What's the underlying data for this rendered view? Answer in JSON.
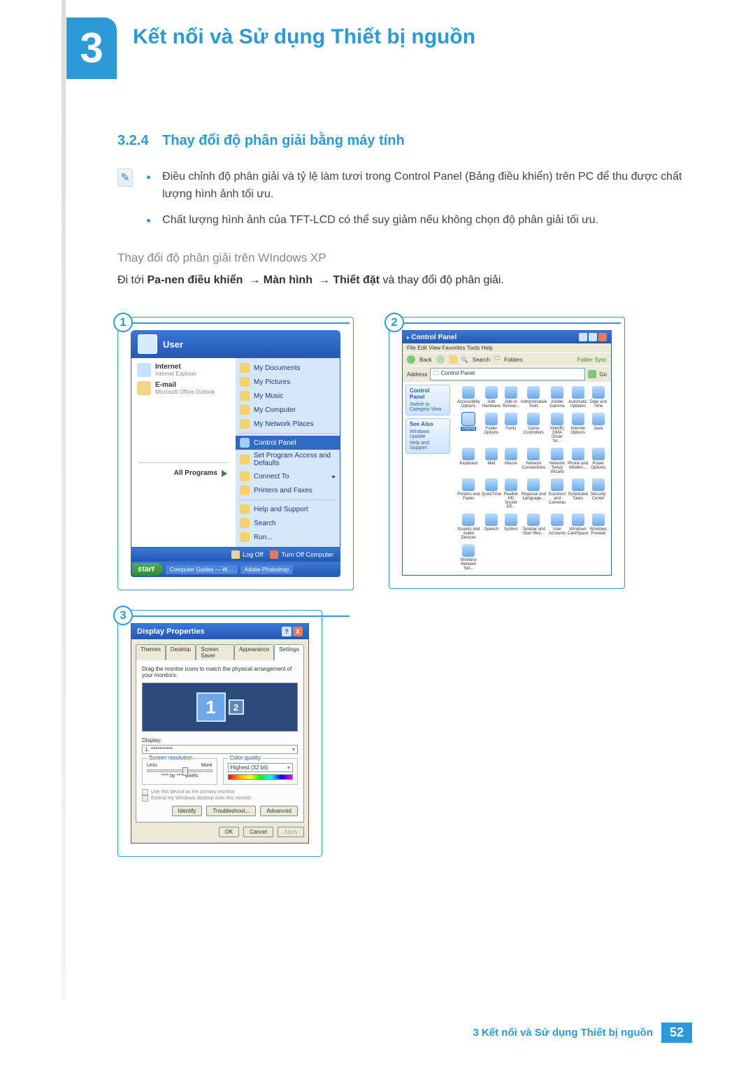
{
  "chapter_number": "3",
  "chapter_title": "Kết nối và Sử dụng Thiết bị nguồn",
  "section": {
    "number": "3.2.4",
    "title": "Thay đổi độ phân giải bằng máy tính"
  },
  "notes": [
    "Điều chỉnh độ phân giải và tỷ lệ làm tươi trong Control Panel (Bảng điều khiển) trên PC để thu được chất lượng hình ảnh tối ưu.",
    "Chất lượng hình ảnh của TFT-LCD có thể suy giảm nếu không chọn độ phân giải tối ưu."
  ],
  "sub_heading": "Thay đổi độ phân giải trên WIndows XP",
  "instruction_pre": "Đi tới ",
  "instruction_mid": " và thay đổi độ phân giải.",
  "path": {
    "p1": "Pa-nen điều khiển",
    "p2": "Màn hình",
    "p3": "Thiết đặt"
  },
  "fig_labels": {
    "f1": "1",
    "f2": "2",
    "f3": "3"
  },
  "start_menu": {
    "user": "User",
    "left": {
      "internet": "Internet",
      "internet_sub": "Internet Explorer",
      "email": "E-mail",
      "email_sub": "Microsoft Office Outlook",
      "all_programs": "All Programs"
    },
    "right": [
      "My Documents",
      "My Pictures",
      "My Music",
      "My Computer",
      "My Network Places",
      "Control Panel",
      "Set Program Access and Defaults",
      "Connect To",
      "Printers and Faxes",
      "Help and Support",
      "Search",
      "Run..."
    ],
    "logoff": "Log Off",
    "turnoff": "Turn Off Computer",
    "start": "start",
    "tasks": [
      "Computer Guides — W…",
      "Adobe Photoshop"
    ]
  },
  "control_panel": {
    "title": "Control Panel",
    "menu": "File   Edit   View   Favorites   Tools   Help",
    "toolbar": {
      "back": "Back",
      "search": "Search",
      "folders": "Folders",
      "fs": "Folder Sync"
    },
    "address_label": "Address",
    "address_value": "Control Panel",
    "go": "Go",
    "side_panes": [
      {
        "hd": "Control Panel",
        "lines": [
          "Switch to Category View"
        ]
      },
      {
        "hd": "See Also",
        "lines": [
          "Windows Update",
          "Help and Support"
        ]
      }
    ],
    "icons": [
      "Accessibility Options",
      "Add Hardware",
      "Add or Remov...",
      "Administrative Tools",
      "Adobe Gamma",
      "Automatic Updates",
      "Date and Time",
      "Display",
      "Folder Options",
      "Fonts",
      "Game Controllers",
      "Intel(R) GMA Driver for...",
      "Internet Options",
      "Java",
      "Keyboard",
      "Mail",
      "Mouse",
      "Network Connections",
      "Network Setup Wizard",
      "Phone and Modem...",
      "Power Options",
      "Printers and Faxes",
      "QuickTime",
      "Realtek HD Sound Eff...",
      "Regional and Language...",
      "Scanners and Cameras",
      "Scheduled Tasks",
      "Security Center",
      "Sounds and Audio Devices",
      "Speech",
      "System",
      "Taskbar and Start Men...",
      "User Accounts",
      "Windows CardSpace",
      "Windows Firewall",
      "Wireless Network Set..."
    ],
    "selected_index": 7
  },
  "display_props": {
    "title": "Display Properties",
    "tabs": [
      "Themes",
      "Desktop",
      "Screen Saver",
      "Appearance",
      "Settings"
    ],
    "active_tab": 4,
    "desc": "Drag the monitor icons to match the physical arrangement of your monitors.",
    "mon1": "1",
    "mon2": "2",
    "display_label": "Display:",
    "display_value": "1. **********",
    "sr_legend": "Screen resolution",
    "sr_less": "Less",
    "sr_more": "More",
    "sr_value": "**** by **** pixels",
    "cq_legend": "Color quality",
    "cq_value": "Highest (32 bit)",
    "check1": "Use this device as the primary monitor.",
    "check2": "Extend my Windows desktop onto this monitor.",
    "btn_identify": "Identify",
    "btn_trouble": "Troubleshoot...",
    "btn_advanced": "Advanced",
    "btn_ok": "OK",
    "btn_cancel": "Cancel",
    "btn_apply": "Apply",
    "help": "?",
    "close": "X"
  },
  "footer": {
    "chapter_ref": "3 Kết nối và Sử dụng Thiết bị nguồn",
    "page": "52"
  }
}
